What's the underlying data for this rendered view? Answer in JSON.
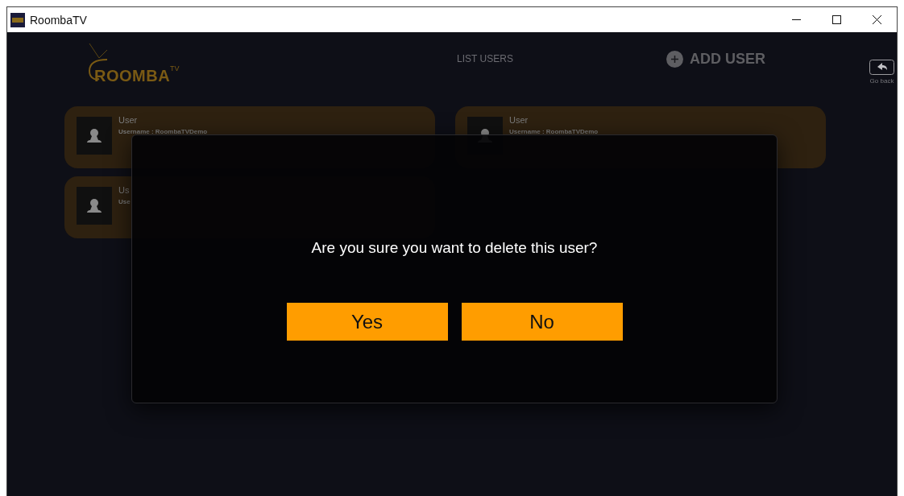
{
  "window": {
    "title": "RoombaTV"
  },
  "logo": {
    "name": "ROOMBA",
    "mark": "TV"
  },
  "nav": {
    "title": "LIST USERS",
    "add_user": "ADD USER",
    "go_back": "Go back"
  },
  "users": [
    {
      "name": "User",
      "username": "Username : RoombaTVDemo"
    },
    {
      "name": "User",
      "username": "Username : RoombaTVDemo"
    },
    {
      "name": "Us",
      "username": "Use"
    }
  ],
  "dialog": {
    "message": "Are you sure you want to delete this user?",
    "buttons": [
      "Yes",
      "No"
    ]
  }
}
